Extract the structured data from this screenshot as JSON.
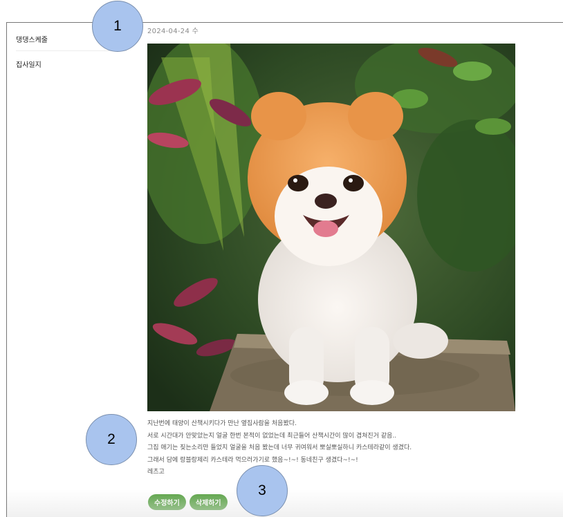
{
  "sidebar": {
    "items": [
      {
        "label": "댕댕스케줄"
      },
      {
        "label": "집사일지"
      }
    ]
  },
  "post": {
    "date": "2024-04-24 수",
    "lines": [
      "지난번에 태양이 산책시키다가 만난 옆집사람을 처음봤다.",
      "서로 시간대가 안맞았는지 얼굴 한번 본적이 없었는데 최근들어 산책시간이 많이 겹쳐진거 같음..",
      "그집 애기는 짖는소리만 들었지 얼굴을 처음 봤는데 너무 귀여워서 뽀실뽀실하니 카스테라같이 생겼다.",
      "그래서 담에 랑블랑제리 카스테라 먹으러가기로 했음~!~! 동네친구 생겼다~!~!",
      "레츠고"
    ]
  },
  "actions": {
    "edit_label": "수정하기",
    "delete_label": "삭제하기"
  },
  "annotations": {
    "one": "1",
    "two": "2",
    "three": "3"
  },
  "colors": {
    "button": "#55a040",
    "callout": "#a9c4ee"
  }
}
